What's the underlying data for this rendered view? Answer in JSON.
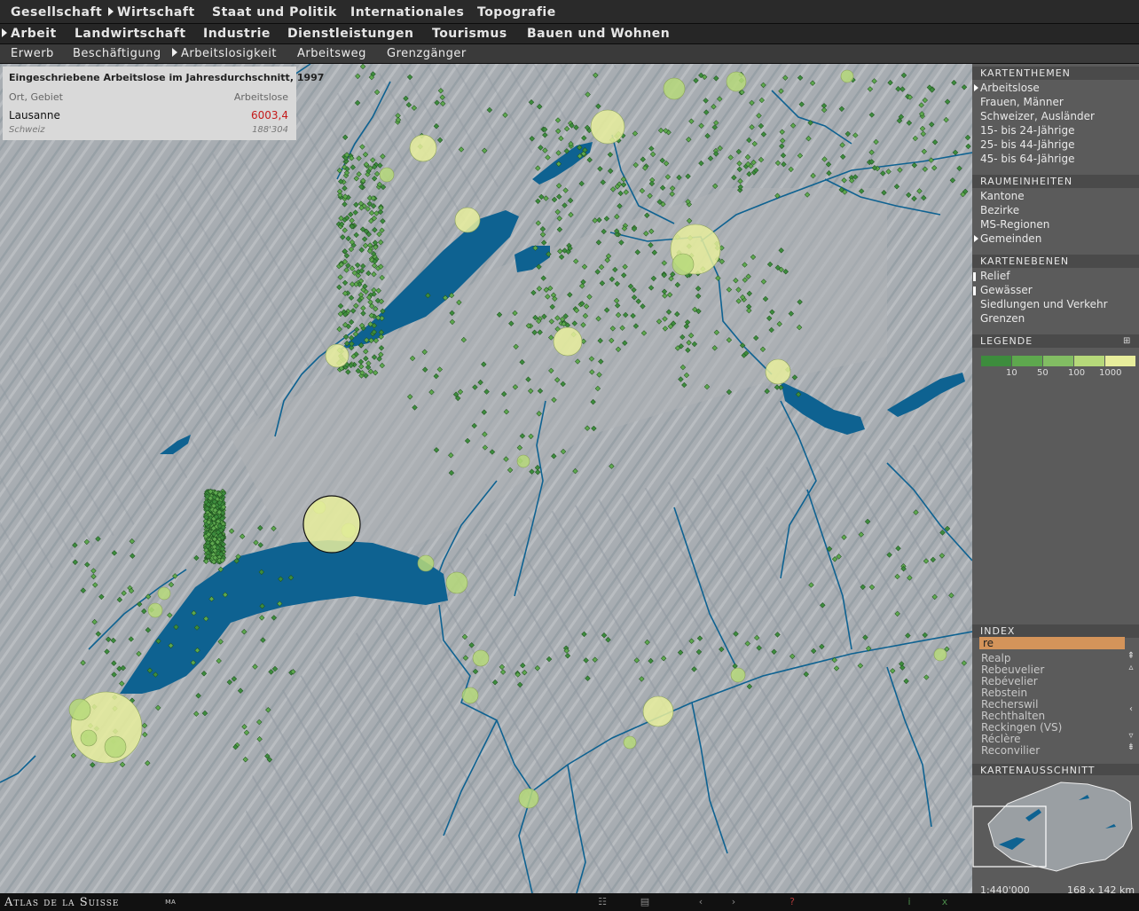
{
  "nav": {
    "level1": [
      "Gesellschaft",
      "Wirtschaft",
      "Staat und Politik",
      "Internationales",
      "Topografie"
    ],
    "level2": [
      "Arbeit",
      "Landwirtschaft",
      "Industrie",
      "Dienstleistungen",
      "Tourismus",
      "Bauen und Wohnen"
    ],
    "level3": [
      "Erwerb",
      "Beschäftigung",
      "Arbeitslosigkeit",
      "Arbeitsweg",
      "Grenzgänger"
    ]
  },
  "infobox": {
    "title": "Eingeschriebene Arbeitslose im Jahresdurchschnitt, 1997",
    "col_place": "Ort, Gebiet",
    "col_value": "Arbeitslose",
    "row_place": "Lausanne",
    "row_value": "6003,4",
    "total_place": "Schweiz",
    "total_value": "188'304"
  },
  "panel": {
    "kartenthemen": {
      "header": "KARTENTHEMEN",
      "items": [
        "Arbeitslose",
        "Frauen, Männer",
        "Schweizer, Ausländer",
        "15- bis 24-Jährige",
        "25- bis 44-Jährige",
        "45- bis 64-Jährige"
      ]
    },
    "raumeinheiten": {
      "header": "RAUMEINHEITEN",
      "items": [
        "Kantone",
        "Bezirke",
        "MS-Regionen",
        "Gemeinden"
      ]
    },
    "kartenebenen": {
      "header": "KARTENEBENEN",
      "items": [
        "Relief",
        "Gewässer",
        "Siedlungen und Verkehr",
        "Grenzen"
      ]
    },
    "legende": {
      "header": "LEGENDE",
      "colors": [
        "#3d8c3d",
        "#5ea84e",
        "#82bd63",
        "#b6d97a",
        "#e8ee9c"
      ],
      "ticks": [
        "10",
        "50",
        "100",
        "1000"
      ]
    },
    "index": {
      "header": "INDEX",
      "query": "re",
      "items": [
        "Realp",
        "Rebeuvelier",
        "Rebévelier",
        "Rebstein",
        "Recherswil",
        "Rechthalten",
        "Reckingen (VS)",
        "Réclère",
        "Reconvilier"
      ]
    },
    "kartenausschnitt": {
      "header": "KARTENAUSSCHNITT"
    }
  },
  "footer": {
    "brand": "Atlas de la Suisse",
    "scale": "1:440'000",
    "extent": "168 x 142 km"
  },
  "colors": {
    "lake": "#0e6291",
    "relief": "#a8adb2",
    "accent_value": "#c41a1a",
    "index_input": "#d4945a"
  }
}
